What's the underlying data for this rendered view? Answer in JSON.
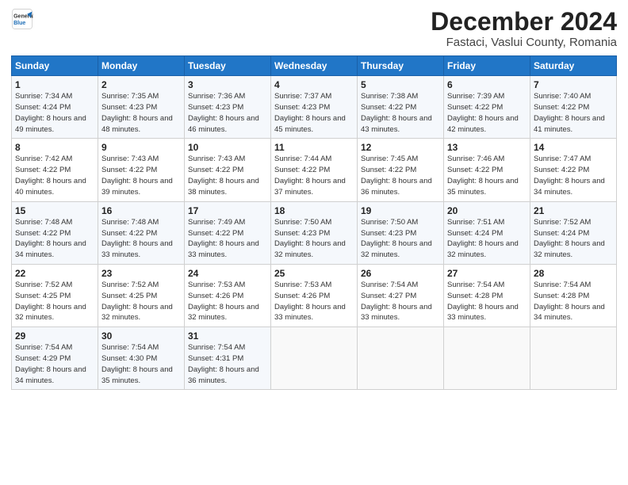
{
  "header": {
    "logo_line1": "General",
    "logo_line2": "Blue",
    "month": "December 2024",
    "location": "Fastaci, Vaslui County, Romania"
  },
  "weekdays": [
    "Sunday",
    "Monday",
    "Tuesday",
    "Wednesday",
    "Thursday",
    "Friday",
    "Saturday"
  ],
  "weeks": [
    [
      {
        "day": "1",
        "sunrise": "7:34 AM",
        "sunset": "4:24 PM",
        "daylight": "8 hours and 49 minutes."
      },
      {
        "day": "2",
        "sunrise": "7:35 AM",
        "sunset": "4:23 PM",
        "daylight": "8 hours and 48 minutes."
      },
      {
        "day": "3",
        "sunrise": "7:36 AM",
        "sunset": "4:23 PM",
        "daylight": "8 hours and 46 minutes."
      },
      {
        "day": "4",
        "sunrise": "7:37 AM",
        "sunset": "4:23 PM",
        "daylight": "8 hours and 45 minutes."
      },
      {
        "day": "5",
        "sunrise": "7:38 AM",
        "sunset": "4:22 PM",
        "daylight": "8 hours and 43 minutes."
      },
      {
        "day": "6",
        "sunrise": "7:39 AM",
        "sunset": "4:22 PM",
        "daylight": "8 hours and 42 minutes."
      },
      {
        "day": "7",
        "sunrise": "7:40 AM",
        "sunset": "4:22 PM",
        "daylight": "8 hours and 41 minutes."
      }
    ],
    [
      {
        "day": "8",
        "sunrise": "7:42 AM",
        "sunset": "4:22 PM",
        "daylight": "8 hours and 40 minutes."
      },
      {
        "day": "9",
        "sunrise": "7:43 AM",
        "sunset": "4:22 PM",
        "daylight": "8 hours and 39 minutes."
      },
      {
        "day": "10",
        "sunrise": "7:43 AM",
        "sunset": "4:22 PM",
        "daylight": "8 hours and 38 minutes."
      },
      {
        "day": "11",
        "sunrise": "7:44 AM",
        "sunset": "4:22 PM",
        "daylight": "8 hours and 37 minutes."
      },
      {
        "day": "12",
        "sunrise": "7:45 AM",
        "sunset": "4:22 PM",
        "daylight": "8 hours and 36 minutes."
      },
      {
        "day": "13",
        "sunrise": "7:46 AM",
        "sunset": "4:22 PM",
        "daylight": "8 hours and 35 minutes."
      },
      {
        "day": "14",
        "sunrise": "7:47 AM",
        "sunset": "4:22 PM",
        "daylight": "8 hours and 34 minutes."
      }
    ],
    [
      {
        "day": "15",
        "sunrise": "7:48 AM",
        "sunset": "4:22 PM",
        "daylight": "8 hours and 34 minutes."
      },
      {
        "day": "16",
        "sunrise": "7:48 AM",
        "sunset": "4:22 PM",
        "daylight": "8 hours and 33 minutes."
      },
      {
        "day": "17",
        "sunrise": "7:49 AM",
        "sunset": "4:22 PM",
        "daylight": "8 hours and 33 minutes."
      },
      {
        "day": "18",
        "sunrise": "7:50 AM",
        "sunset": "4:23 PM",
        "daylight": "8 hours and 32 minutes."
      },
      {
        "day": "19",
        "sunrise": "7:50 AM",
        "sunset": "4:23 PM",
        "daylight": "8 hours and 32 minutes."
      },
      {
        "day": "20",
        "sunrise": "7:51 AM",
        "sunset": "4:24 PM",
        "daylight": "8 hours and 32 minutes."
      },
      {
        "day": "21",
        "sunrise": "7:52 AM",
        "sunset": "4:24 PM",
        "daylight": "8 hours and 32 minutes."
      }
    ],
    [
      {
        "day": "22",
        "sunrise": "7:52 AM",
        "sunset": "4:25 PM",
        "daylight": "8 hours and 32 minutes."
      },
      {
        "day": "23",
        "sunrise": "7:52 AM",
        "sunset": "4:25 PM",
        "daylight": "8 hours and 32 minutes."
      },
      {
        "day": "24",
        "sunrise": "7:53 AM",
        "sunset": "4:26 PM",
        "daylight": "8 hours and 32 minutes."
      },
      {
        "day": "25",
        "sunrise": "7:53 AM",
        "sunset": "4:26 PM",
        "daylight": "8 hours and 33 minutes."
      },
      {
        "day": "26",
        "sunrise": "7:54 AM",
        "sunset": "4:27 PM",
        "daylight": "8 hours and 33 minutes."
      },
      {
        "day": "27",
        "sunrise": "7:54 AM",
        "sunset": "4:28 PM",
        "daylight": "8 hours and 33 minutes."
      },
      {
        "day": "28",
        "sunrise": "7:54 AM",
        "sunset": "4:28 PM",
        "daylight": "8 hours and 34 minutes."
      }
    ],
    [
      {
        "day": "29",
        "sunrise": "7:54 AM",
        "sunset": "4:29 PM",
        "daylight": "8 hours and 34 minutes."
      },
      {
        "day": "30",
        "sunrise": "7:54 AM",
        "sunset": "4:30 PM",
        "daylight": "8 hours and 35 minutes."
      },
      {
        "day": "31",
        "sunrise": "7:54 AM",
        "sunset": "4:31 PM",
        "daylight": "8 hours and 36 minutes."
      },
      null,
      null,
      null,
      null
    ]
  ]
}
